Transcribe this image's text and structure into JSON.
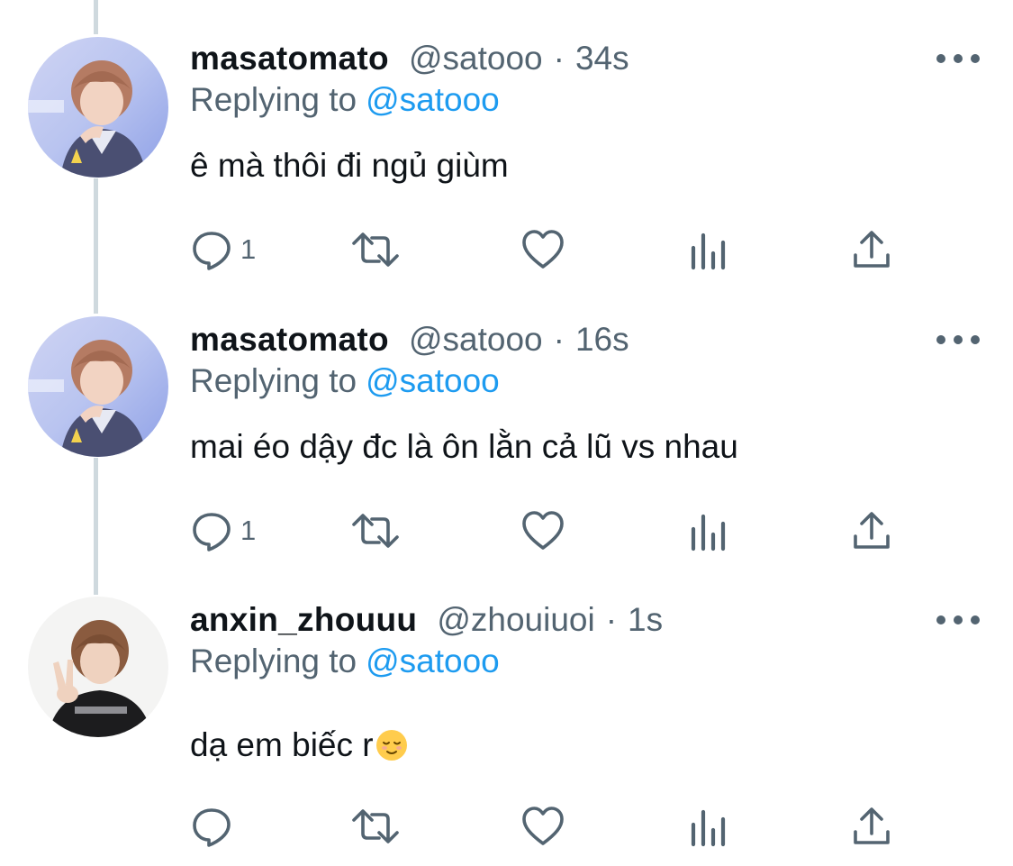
{
  "tweets": [
    {
      "display_name": "masatomato",
      "handle": "@satooo",
      "separator": "·",
      "time": "34s",
      "replying_prefix": "Replying to",
      "replying_to": "@satooo",
      "text": "ê mà thôi đi ngủ giùm",
      "reply_count": "1",
      "avatar_icon": "profile-photo-boy-lavender-background"
    },
    {
      "display_name": "masatomato",
      "handle": "@satooo",
      "separator": "·",
      "time": "16s",
      "replying_prefix": "Replying to",
      "replying_to": "@satooo",
      "text": "mai éo dậy đc là ôn lằn cả lũ vs nhau",
      "reply_count": "1",
      "avatar_icon": "profile-photo-boy-lavender-background"
    },
    {
      "display_name": "anxin_zhouuu",
      "handle": "@zhouiuoi",
      "separator": "·",
      "time": "1s",
      "replying_prefix": "Replying to",
      "replying_to": "@satooo",
      "text": "dạ em biếc r",
      "text_emoji": "relieved-face-emoji",
      "reply_count": "",
      "avatar_icon": "profile-photo-boy-peace-sign"
    }
  ],
  "icons": {
    "reply": "reply-icon",
    "retweet": "retweet-icon",
    "like": "like-heart-icon",
    "views": "analytics-icon",
    "share": "share-icon",
    "more": "more-options-icon"
  },
  "colors": {
    "text_primary": "#0f1419",
    "text_secondary": "#536471",
    "mention": "#1d9bf0",
    "thread_line": "#cfd9de"
  }
}
